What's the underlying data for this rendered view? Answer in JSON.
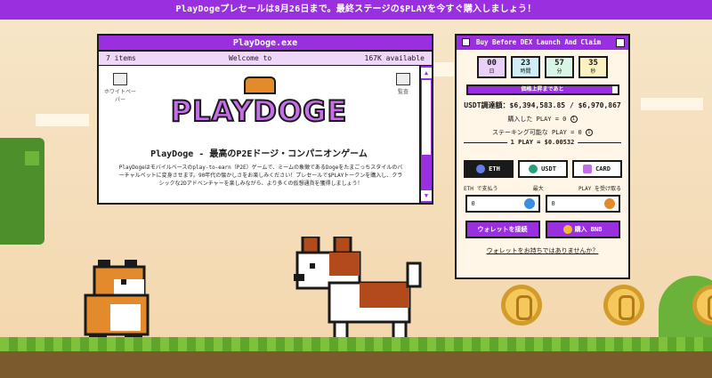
{
  "banner": {
    "text": "PlayDogeプレセールは8月26日まで。最終ステージの$PLAYを今すぐ購入しましょう！"
  },
  "window": {
    "title": "PlayDoge.exe",
    "status_left": "7 items",
    "status_center": "Welcome to",
    "status_right": "167K available",
    "icon_left_label": "ホワイトペーパー",
    "icon_right_label": "監査",
    "logo_text": "PLAYDOGE",
    "heading": "PlayDoge - 最高のP2Eドージ・コンパニオンゲーム",
    "description": "PlayDogeはモバイルベースのplay-to-earn（P2E）ゲームで、ミームの象徴であるDogeをたまごっちスタイルのバーチャルペットに変身させます。90年代の懐かしさをお楽しみください！プレセールで$PLAYトークンを購入し、クラシックな2Dアドベンチャーを楽しみながら、より多くの仮想通貨を獲得しましょう！"
  },
  "widget": {
    "title": "Buy Before DEX Launch And Claim",
    "timer": [
      {
        "value": "00",
        "unit": "日"
      },
      {
        "value": "23",
        "unit": "時間"
      },
      {
        "value": "57",
        "unit": "分"
      },
      {
        "value": "35",
        "unit": "秒"
      }
    ],
    "progress_label": "価格上昇まであと",
    "progress_fraction": 0.97,
    "raised": "USDT調達額：$6,394,583.85 / $6,970,867",
    "purchased": "購入した PLAY = 0",
    "stakeable": "ステーキング可能な PLAY = 0",
    "rate": "1 PLAY = $0.00532",
    "pay_tabs": [
      {
        "label": "ETH",
        "active": true,
        "color": "#627eea"
      },
      {
        "label": "USDT",
        "active": false,
        "color": "#26a17b"
      },
      {
        "label": "CARD",
        "active": false,
        "color": "#c56ee8"
      }
    ],
    "pay_label": "ETH で支払う",
    "max_label": "最大",
    "receive_label": "PLAY を受け取る",
    "pay_value": "0",
    "receive_value": "0",
    "connect_button": "ウォレットを接続",
    "buy_bnb_button": "購入 BNB",
    "no_wallet_link": "ウォレットをお持ちではありませんか？"
  },
  "colors": {
    "accent": "#9a2fe0",
    "ground": "#7b5a2e",
    "grass": "#7dc23a"
  }
}
